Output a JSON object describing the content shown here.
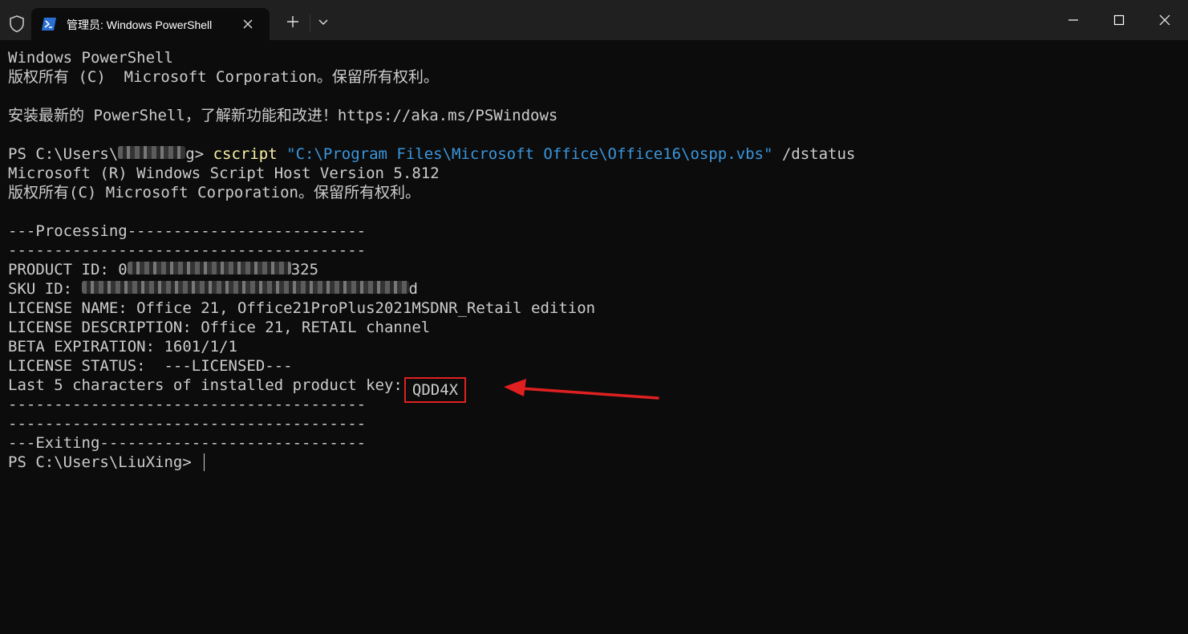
{
  "titlebar": {
    "tab_title": "管理员: Windows PowerShell",
    "icons": [
      "shield-icon",
      "powershell-icon",
      "close-icon",
      "plus-icon",
      "chevron-down-icon",
      "minimize-icon",
      "maximize-icon",
      "close-icon"
    ]
  },
  "terminal": {
    "banner_title": "Windows PowerShell",
    "banner_copyright": "版权所有 (C)  Microsoft Corporation。保留所有权利。",
    "banner_install": "安装最新的 PowerShell，了解新功能和改进！https://aka.ms/PSWindows",
    "prompt1_prefix": "PS C:\\Users\\",
    "prompt1_user_blurred": "l      _",
    "prompt1_suffix": "g> ",
    "command": "cscript",
    "command_arg": "\"C:\\Program Files\\Microsoft Office\\Office16\\ospp.vbs\"",
    "command_flag": " /dstatus",
    "wsh_version": "Microsoft (R) Windows Script Host Version 5.812",
    "wsh_copyright": "版权所有(C) Microsoft Corporation。保留所有权利。",
    "processing": "---Processing--------------------------",
    "dash_line": "---------------------------------------",
    "product_id_label": "PRODUCT ID: 0",
    "product_id_blur": "0000-00000-000-00",
    "product_id_tail": "325",
    "sku_id_label": "SKU ID: ",
    "sku_id_blur": "00000000-0000-0000-0000-0000000000",
    "sku_id_tail": "d",
    "license_name": "LICENSE NAME: Office 21, Office21ProPlus2021MSDNR_Retail edition",
    "license_description": "LICENSE DESCRIPTION: Office 21, RETAIL channel",
    "beta_expiration": "BETA EXPIRATION: 1601/1/1",
    "license_status": "LICENSE STATUS:  ---LICENSED---",
    "last5_label": "Last 5 characters of installed product key:",
    "last5_value": "QDD4X",
    "exiting": "---Exiting-----------------------------",
    "prompt2": "PS C:\\Users\\LiuXing> "
  },
  "colors": {
    "background": "#0c0c0c",
    "titlebar": "#202020",
    "text": "#cccccc",
    "command": "#f9f1a5",
    "string": "#3a96dd",
    "annotation": "#e02020"
  }
}
